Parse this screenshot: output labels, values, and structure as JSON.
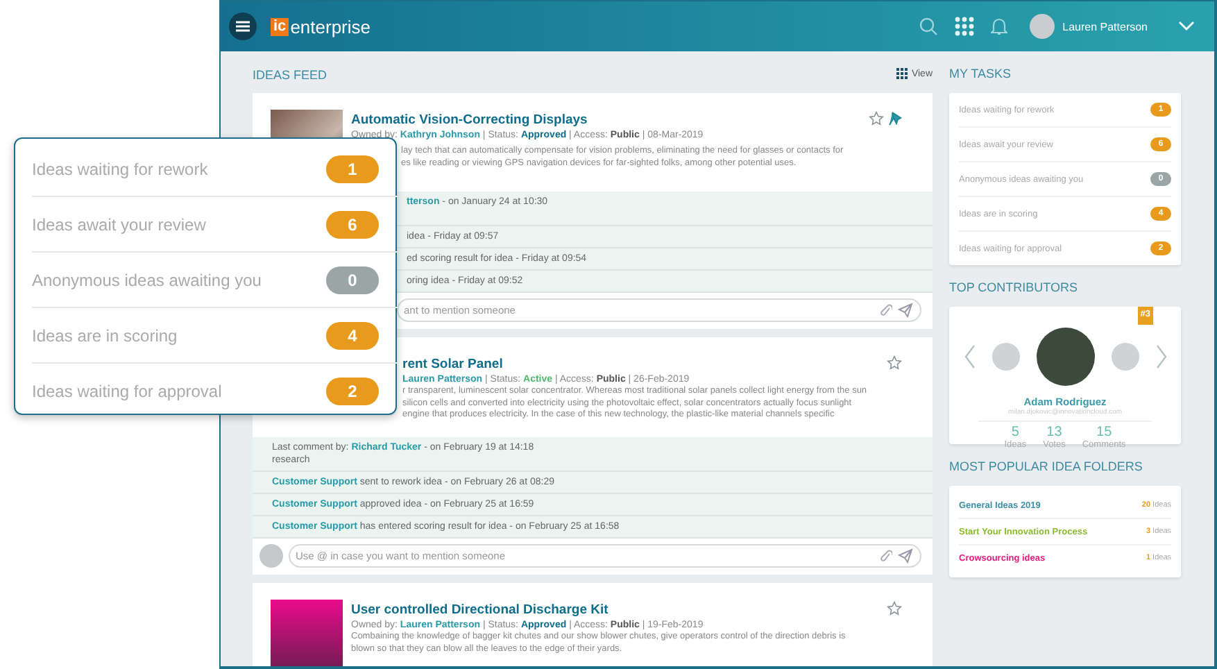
{
  "header": {
    "logo_mark": "ic",
    "logo_text": "enterprise",
    "user_name": "Lauren Patterson"
  },
  "feed": {
    "title": "IDEAS FEED",
    "view_label": "View",
    "cards": [
      {
        "image": {
          "kind": "photo"
        },
        "title": "Automatic Vision-Correcting Displays",
        "owner_label": "Owned by:",
        "owner": "Kathryn Johnson",
        "status_label": "| Status:",
        "status": {
          "text": "Approved",
          "color": "#0f6d8c"
        },
        "access_label": "| Access:",
        "access": "Public",
        "date": "| 08-Mar-2019",
        "starred": false,
        "pinned": true,
        "description_lines": [
          "lay tech that can automatically compensate for vision problems, eliminating the need for glasses or contacts for",
          "es like reading or viewing GPS navigation devices for far-sighted folks, among other potential uses."
        ],
        "activity": [
          {
            "actor": "tterson",
            "text": " - on January 24 at 10:30"
          },
          {
            "text": "idea - Friday at 09:57"
          },
          {
            "text": "ed scoring result for idea - Friday at 09:54"
          },
          {
            "text": "oring idea - Friday at 09:52"
          }
        ],
        "comment_placeholder": "ant to mention someone"
      },
      {
        "title": "rent Solar Panel",
        "owner": "Lauren Patterson",
        "status_label": "| Status:",
        "status": {
          "text": "Active",
          "color": "#4cbb6c"
        },
        "access_label": "| Access:",
        "access": "Public",
        "date": "| 26-Feb-2019",
        "starred": false,
        "pinned": false,
        "description_lines": [
          "r transparent, luminescent solar concentrator. Whereas most traditional solar panels collect light energy from the sun",
          "silicon cells and converted into electricity using the photovoltaic effect, solar concentrators actually focus sunlight",
          "engine that produces electricity. In the case of this new technology, the plastic-like material channels specific"
        ],
        "activity": [
          {
            "label": "Last comment by: ",
            "actor": "Richard Tucker",
            "text": " - on February 19 at 14:18",
            "note": "research"
          },
          {
            "actor": "Customer Support",
            "text": " sent to rework idea - on February 26 at 08:29"
          },
          {
            "actor": "Customer Support",
            "text": " approved idea - on February 25 at 16:59"
          },
          {
            "actor": "Customer Support",
            "text": " has entered scoring result for idea - on February 25 at 16:58"
          }
        ],
        "comment_placeholder": "Use @ in case you want to mention someone",
        "comment_avatar": true
      },
      {
        "image": {
          "kind": "pattern"
        },
        "title": "User controlled Directional Discharge Kit",
        "owner_label": "Owned by:",
        "owner": "Lauren Patterson",
        "status_label": "| Status:",
        "status": {
          "text": "Approved",
          "color": "#0f6d8c"
        },
        "access_label": "| Access:",
        "access": "Public",
        "date": "| 19-Feb-2019",
        "starred": false,
        "pinned": false,
        "description_lines": [
          "Combaining the knowledge of bagger kit chutes and our show blower chutes, give operators control of the direction debris is",
          "blown so that they can blow all the leaves to the edge of their yards."
        ]
      }
    ]
  },
  "my_tasks": {
    "title": "MY TASKS",
    "items": [
      {
        "label": "Ideas waiting for rework",
        "count": "1",
        "color": "#e89a1c"
      },
      {
        "label": "Ideas await your review",
        "count": "6",
        "color": "#e89a1c"
      },
      {
        "label": "Anonymous ideas awaiting you",
        "count": "0",
        "color": "#9aa6a6"
      },
      {
        "label": "Ideas are in scoring",
        "count": "4",
        "color": "#e89a1c"
      },
      {
        "label": "Ideas waiting for approval",
        "count": "2",
        "color": "#e89a1c"
      }
    ]
  },
  "top_contributors": {
    "title": "TOP CONTRIBUTORS",
    "rank": "#3",
    "name": "Adam Rodriguez",
    "email": "milan.djokovic@innovationcloud.com",
    "stats": [
      {
        "value": "5",
        "label": "Ideas"
      },
      {
        "value": "13",
        "label": "Votes"
      },
      {
        "value": "15",
        "label": "Comments"
      }
    ]
  },
  "idea_folders": {
    "title": "MOST POPULAR IDEA FOLDERS",
    "items": [
      {
        "name": "General Ideas 2019",
        "count": "20",
        "unit": "Ideas",
        "color": "#3d8fa6"
      },
      {
        "name": "Start Your Innovation Process",
        "count": "3",
        "unit": "Ideas",
        "color": "#8bbb2e"
      },
      {
        "name": "Crowsourcing ideas",
        "count": "1",
        "unit": "Ideas",
        "color": "#e6197e"
      }
    ]
  },
  "callout": {
    "items": [
      {
        "label": "Ideas waiting for rework",
        "count": "1",
        "color": "#e89a1c"
      },
      {
        "label": "Ideas await your review",
        "count": "6",
        "color": "#e89a1c"
      },
      {
        "label": "Anonymous ideas awaiting you",
        "count": "0",
        "color": "#9aa6a6"
      },
      {
        "label": "Ideas are in scoring",
        "count": "4",
        "color": "#e89a1c"
      },
      {
        "label": "Ideas waiting for approval",
        "count": "2",
        "color": "#e89a1c"
      }
    ]
  }
}
